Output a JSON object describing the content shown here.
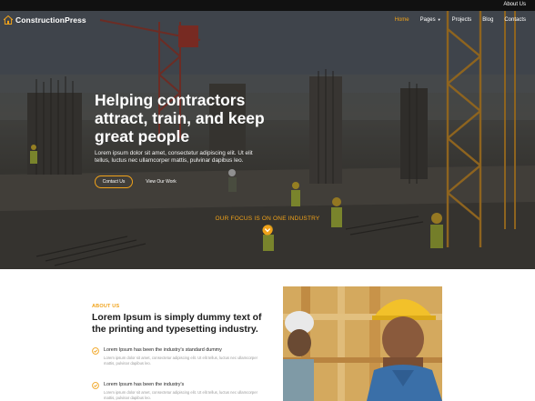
{
  "topbar": {
    "about_link": "About Us"
  },
  "brand": {
    "name": "ConstructionPress",
    "icon": "house-logo-icon"
  },
  "nav": {
    "items": [
      {
        "label": "Home",
        "active": true
      },
      {
        "label": "Pages",
        "dropdown": true
      },
      {
        "label": "Projects"
      },
      {
        "label": "Blog"
      },
      {
        "label": "Contacts"
      }
    ]
  },
  "hero": {
    "title": "Helping contractors attract, train, and keep great people",
    "text": "Lorem ipsum dolor sit amet, consectetur adipiscing elit. Ut elit tellus, luctus nec ullamcorper mattis, pulvinar dapibus leo.",
    "primary_button": "Contact Us",
    "secondary_button": "View Our Work",
    "focus_text": "OUR FOCUS IS ON ONE INDUSTRY",
    "scroll_icon": "chevron-down-circle-icon"
  },
  "about": {
    "label": "ABOUT US",
    "title": "Lorem Ipsum is simply dummy text of the printing and typesetting industry.",
    "features": [
      {
        "title": "Lorem Ipsum has been the industry's standard dummy",
        "text": "Lorem ipsum dolor sit amet, consectetur adipiscing elit. Ut elit tellus, luctus nec ullamcorper mattis, pulvinar dapibus leo.",
        "icon": "check-circle-icon"
      },
      {
        "title": "Lorem Ipsum has been the industry's",
        "text": "Lorem ipsum dolor sit amet, consectetur adipiscing elit. Ut elit tellus, luctus nec ullamcorper mattis, pulvinar dapibus leo.",
        "icon": "check-circle-icon"
      }
    ]
  },
  "colors": {
    "accent": "#f0a21a",
    "dark": "#111111",
    "text": "#1b1b1b",
    "muted": "#9a9a9a"
  }
}
